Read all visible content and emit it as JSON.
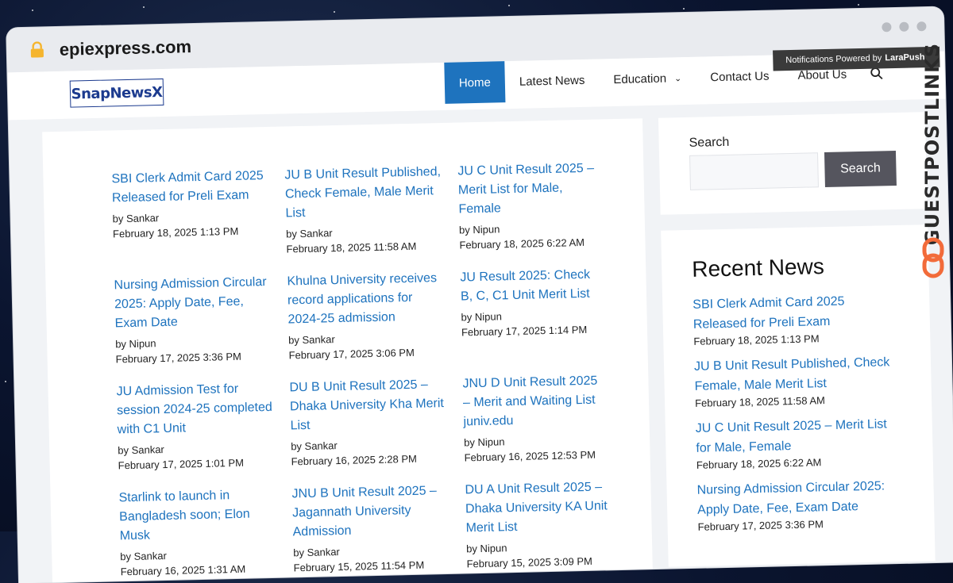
{
  "browser": {
    "url": "epiexpress.com"
  },
  "site": {
    "logo": "SnapNewsX",
    "nav": [
      {
        "label": "Home"
      },
      {
        "label": "Latest News"
      },
      {
        "label": "Education"
      },
      {
        "label": "Contact Us"
      },
      {
        "label": "About Us"
      }
    ],
    "notification_prefix": "Notifications Powered by",
    "notification_brand": "LaraPush"
  },
  "posts": [
    {
      "title": "SBI Clerk Admit Card 2025 Released for Preli Exam",
      "author": "by Sankar",
      "date": "February 18, 2025 1:13 PM"
    },
    {
      "title": "JU B Unit Result Published, Check Female, Male Merit List",
      "author": "by Sankar",
      "date": "February 18, 2025 11:58 AM"
    },
    {
      "title": "JU C Unit Result 2025 – Merit List for Male, Female",
      "author": "by Nipun",
      "date": "February 18, 2025 6:22 AM"
    },
    {
      "title": "Nursing Admission Circular 2025: Apply Date, Fee, Exam Date",
      "author": "by Nipun",
      "date": "February 17, 2025 3:36 PM"
    },
    {
      "title": "Khulna University receives record applications for 2024-25 admission",
      "author": "by Sankar",
      "date": "February 17, 2025 3:06 PM"
    },
    {
      "title": "JU Result 2025: Check B, C, C1 Unit Merit List",
      "author": "by Nipun",
      "date": "February 17, 2025 1:14 PM"
    },
    {
      "title": "JU Admission Test for session 2024-25 completed with C1 Unit",
      "author": "by Sankar",
      "date": "February 17, 2025 1:01 PM"
    },
    {
      "title": "DU B Unit Result 2025 – Dhaka University Kha Merit List",
      "author": "by Sankar",
      "date": "February 16, 2025 2:28 PM"
    },
    {
      "title": "JNU D Unit Result 2025 – Merit and Waiting List juniv.edu",
      "author": "by Nipun",
      "date": "February 16, 2025 12:53 PM"
    },
    {
      "title": "Starlink to launch in Bangladesh soon; Elon Musk",
      "author": "by Sankar",
      "date": "February 16, 2025 1:31 AM"
    },
    {
      "title": "JNU B Unit Result 2025 – Jagannath University Admission",
      "author": "by Sankar",
      "date": "February 15, 2025 11:54 PM"
    },
    {
      "title": "DU A Unit Result 2025 – Dhaka University KA Unit Merit List",
      "author": "by Nipun",
      "date": "February 15, 2025 3:09 PM"
    }
  ],
  "sidebar": {
    "search_label": "Search",
    "search_button": "Search",
    "recent_title": "Recent News",
    "recent": [
      {
        "title": "SBI Clerk Admit Card 2025 Released for Preli Exam",
        "date": "February 18, 2025 1:13 PM"
      },
      {
        "title": "JU B Unit Result Published, Check Female, Male Merit List",
        "date": "February 18, 2025 11:58 AM"
      },
      {
        "title": "JU C Unit Result 2025 – Merit List for Male, Female",
        "date": "February 18, 2025 6:22 AM"
      },
      {
        "title": "Nursing Admission Circular 2025: Apply Date, Fee, Exam Date",
        "date": "February 17, 2025 3:36 PM"
      }
    ]
  },
  "overlay": {
    "watermark": "GUESTPOSTLINKS"
  },
  "colors": {
    "accent": "#1e73be",
    "search_button": "#55555e",
    "watermark_logo": "#f26b3a"
  },
  "icons": [
    "lock-icon",
    "search-icon",
    "chevron-down-icon",
    "window-dot-icon",
    "link-icon"
  ]
}
